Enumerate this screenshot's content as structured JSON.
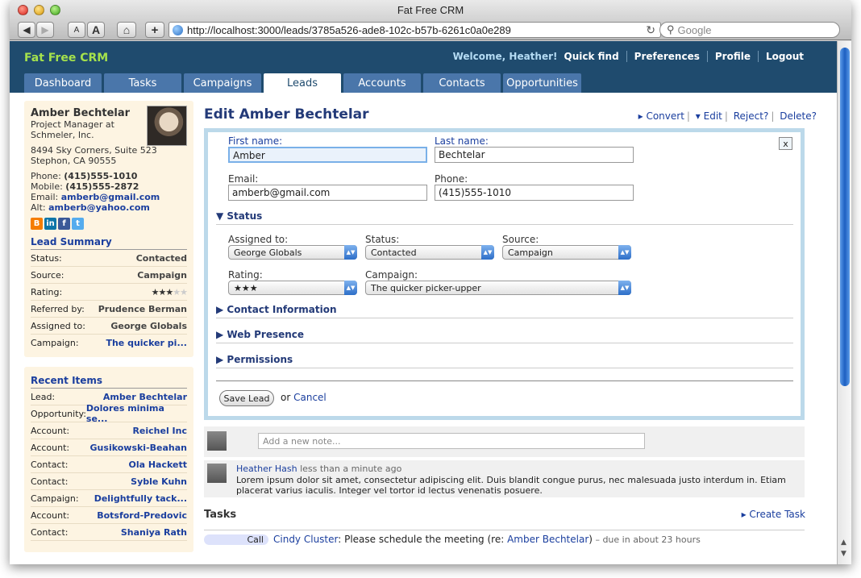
{
  "window": {
    "title": "Fat Free CRM",
    "url": "http://localhost:3000/leads/3785a526-ade8-102c-b57b-6261c0a0e289",
    "search_placeholder": "Google"
  },
  "toolbar": {
    "text_small": "A",
    "text_large": "A",
    "home": "⌂",
    "add": "+"
  },
  "app": {
    "logo": "Fat Free CRM",
    "welcome": "Welcome, Heather!",
    "top_links": [
      "Quick find",
      "Preferences",
      "Profile",
      "Logout"
    ],
    "tabs": [
      "Dashboard",
      "Tasks",
      "Campaigns",
      "Leads",
      "Accounts",
      "Contacts",
      "Opportunities"
    ],
    "active_tab": "Leads"
  },
  "contact": {
    "name": "Amber Bechtelar",
    "title_line1": "Project Manager at",
    "title_line2": "Schmeler, Inc.",
    "addr1": "8494 Sky Corners, Suite 523",
    "addr2": "Stephon, CA 90555",
    "phone_label": "Phone:",
    "phone": "(415)555-1010",
    "mobile_label": "Mobile:",
    "mobile": "(415)555-2872",
    "email_label": "Email:",
    "email": "amberb@gmail.com",
    "alt_label": "Alt:",
    "alt": "amberb@yahoo.com"
  },
  "lead_summary": {
    "title": "Lead Summary",
    "rows": [
      {
        "k": "Status:",
        "v": "Contacted"
      },
      {
        "k": "Source:",
        "v": "Campaign"
      },
      {
        "k": "Rating:",
        "v": "★★★"
      },
      {
        "k": "Referred by:",
        "v": "Prudence Berman"
      },
      {
        "k": "Assigned to:",
        "v": "George Globals"
      },
      {
        "k": "Campaign:",
        "v": "The quicker pi..."
      }
    ],
    "rating_off": "★★"
  },
  "recent": {
    "title": "Recent Items",
    "rows": [
      {
        "k": "Lead:",
        "v": "Amber Bechtelar"
      },
      {
        "k": "Opportunity:",
        "v": "Dolores minima se..."
      },
      {
        "k": "Account:",
        "v": "Reichel Inc"
      },
      {
        "k": "Account:",
        "v": "Gusikowski-Beahan"
      },
      {
        "k": "Contact:",
        "v": "Ola Hackett"
      },
      {
        "k": "Contact:",
        "v": "Syble Kuhn"
      },
      {
        "k": "Campaign:",
        "v": "Delightfully tack..."
      },
      {
        "k": "Account:",
        "v": "Botsford-Predovic"
      },
      {
        "k": "Contact:",
        "v": "Shaniya Rath"
      }
    ]
  },
  "edit": {
    "title": "Edit Amber Bechtelar",
    "actions": [
      "▸ Convert",
      "▾ Edit",
      "Reject?",
      "Delete?"
    ],
    "close": "x",
    "first_label": "First name:",
    "first": "Amber",
    "last_label": "Last name:",
    "last": "Bechtelar",
    "email_label": "Email:",
    "email": "amberb@gmail.com",
    "phone_label": "Phone:",
    "phone": "(415)555-1010",
    "status_section": "▼ Status",
    "assigned_label": "Assigned to:",
    "assigned": "George Globals",
    "status_label": "Status:",
    "status": "Contacted",
    "source_label": "Source:",
    "source": "Campaign",
    "rating_label": "Rating:",
    "rating": "★★★",
    "campaign_label": "Campaign:",
    "campaign": "The quicker picker-upper",
    "sections": [
      "▶ Contact Information",
      "▶ Web Presence",
      "▶ Permissions"
    ],
    "save": "Save Lead",
    "or": "or",
    "cancel": "Cancel"
  },
  "notes": {
    "placeholder": "Add a new note...",
    "author": "Heather Hash",
    "time": "less than a minute ago",
    "body1": "Lorem ipsum dolor sit amet, consectetur adipiscing elit. Duis blandit congue purus, nec malesuada justo interdum in. Etiam",
    "body2": "placerat varius iaculis. Integer vel tortor id lectus venenatis posuere."
  },
  "tasks": {
    "title": "Tasks",
    "create": "▸ Create Task",
    "item": {
      "type": "Call",
      "who": "Cindy Cluster",
      "text": ": Please schedule the meeting (re: ",
      "re": "Amber Bechtelar",
      "close": ")",
      "due": " – due in about 23 hours"
    }
  }
}
